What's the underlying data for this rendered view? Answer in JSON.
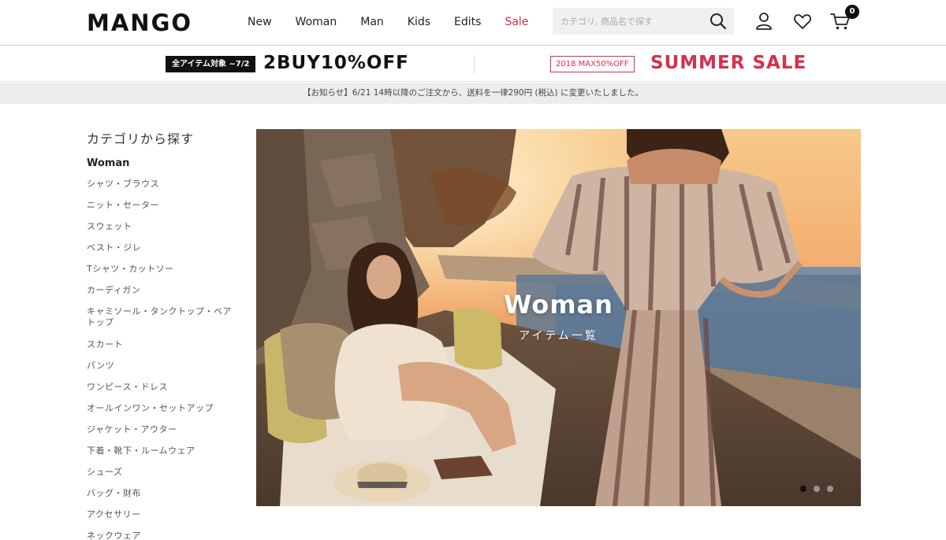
{
  "header": {
    "logo": "MANGO",
    "nav": [
      "New",
      "Woman",
      "Man",
      "Kids",
      "Edits",
      "Sale"
    ],
    "search_placeholder": "カテゴリ, 商品名で探す",
    "cart_count": "0",
    "icons": [
      "search-icon",
      "user-icon",
      "heart-icon",
      "cart-icon"
    ]
  },
  "promo": {
    "tag": "全アイテム対象 ~7/2",
    "main": "2BUY10%OFF",
    "sale_box": "2018 MAX50%OFF",
    "sale_title": "SUMMER SALE"
  },
  "notice": "【お知らせ】6/21 14時以降のご注文から、送料を一律290円 (税込) に変更いたしました。",
  "sidebar": {
    "title": "カテゴリから探す",
    "category": "Woman",
    "items": [
      "シャツ・ブラウス",
      "ニット・セーター",
      "スウェット",
      "ベスト・ジレ",
      "Tシャツ・カットソー",
      "カーディガン",
      "キャミソール・タンクトップ・ベアトップ",
      "スカート",
      "パンツ",
      "ワンピース・ドレス",
      "オールインワン・セットアップ",
      "ジャケット・アウター",
      "下着・靴下・ルームウェア",
      "シューズ",
      "バッグ・財布",
      "アクセサリー",
      "ネックウェア"
    ]
  },
  "hero": {
    "title": "Woman",
    "subtitle": "アイテム一覧",
    "slides": 3,
    "active_slide": 1
  },
  "colors": {
    "sale_red": "#d6304b",
    "black": "#111111",
    "notice_bg": "#ededed"
  }
}
